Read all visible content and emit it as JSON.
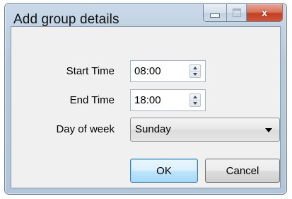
{
  "window": {
    "title": "Add group details",
    "close_symbol": "x",
    "caption_icons": [
      "minimize-icon",
      "maximize-icon",
      "close-icon"
    ]
  },
  "form": {
    "start_time": {
      "label": "Start Time",
      "value": "08:00"
    },
    "end_time": {
      "label": "End Time",
      "value": "18:00"
    },
    "day_of_week": {
      "label": "Day of week",
      "selected": "Sunday"
    }
  },
  "buttons": {
    "ok": "OK",
    "cancel": "Cancel"
  },
  "colors": {
    "frame": "#b7cadc",
    "client": "#f0f0f0",
    "close_button": "#c54022",
    "ok_focus": "#3c7fb1"
  }
}
